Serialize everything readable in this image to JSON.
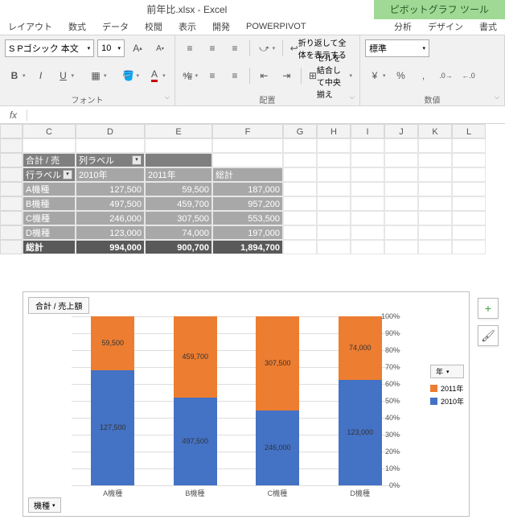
{
  "title": "前年比.xlsx - Excel",
  "tool_tab": "ピボットグラフ ツール",
  "tabs": [
    "レイアウト",
    "数式",
    "データ",
    "校閲",
    "表示",
    "開発",
    "POWERPIVOT"
  ],
  "sub_tabs": [
    "分析",
    "デザイン",
    "書式"
  ],
  "font": {
    "name": "S Pゴシック 本文",
    "size": "10"
  },
  "ribbon_groups": {
    "font": "フォント",
    "align": "配置",
    "number": "数値"
  },
  "align_labels": {
    "wrap": "折り返して全体を表示する",
    "merge": "セルを結合して中央揃え"
  },
  "num_format": "標準",
  "formula": "",
  "cols": [
    "C",
    "D",
    "E",
    "F",
    "G",
    "H",
    "I",
    "J",
    "K",
    "L"
  ],
  "pivot": {
    "measure": "合計 / 売",
    "col_field": "列ラベル",
    "row_field": "行ラベル",
    "col_headers": [
      "2010年",
      "2011年",
      "総計"
    ],
    "rows": [
      {
        "label": "A機種",
        "cells": [
          "127,500",
          "59,500",
          "187,000"
        ]
      },
      {
        "label": "B機種",
        "cells": [
          "497,500",
          "459,700",
          "957,200"
        ]
      },
      {
        "label": "C機種",
        "cells": [
          "246,000",
          "307,500",
          "553,500"
        ]
      },
      {
        "label": "D機種",
        "cells": [
          "123,000",
          "74,000",
          "197,000"
        ]
      }
    ],
    "total": {
      "label": "総計",
      "cells": [
        "994,000",
        "900,700",
        "1,894,700"
      ]
    }
  },
  "chart_data": {
    "type": "bar-stacked-100pct",
    "title": "合計 / 売上額",
    "categories": [
      "A機種",
      "B機種",
      "C機種",
      "D機種"
    ],
    "series": [
      {
        "name": "2010年",
        "values": [
          127500,
          497500,
          246000,
          123000
        ],
        "color": "#4472c4"
      },
      {
        "name": "2011年",
        "values": [
          59500,
          459700,
          307500,
          74000
        ],
        "color": "#ed7d31"
      }
    ],
    "data_labels": {
      "2010": [
        "127,500",
        "497,500",
        "246,000",
        "123,000"
      ],
      "2011": [
        "59,500",
        "459,700",
        "307,500",
        "74,000"
      ]
    },
    "y_ticks": [
      "0%",
      "10%",
      "20%",
      "30%",
      "40%",
      "50%",
      "60%",
      "70%",
      "80%",
      "90%",
      "100%"
    ],
    "legend_title": "年",
    "legend_items": [
      "2011年",
      "2010年"
    ],
    "filter_button": "機種"
  },
  "float_buttons": {
    "plus": "+",
    "brush": "🖌"
  }
}
